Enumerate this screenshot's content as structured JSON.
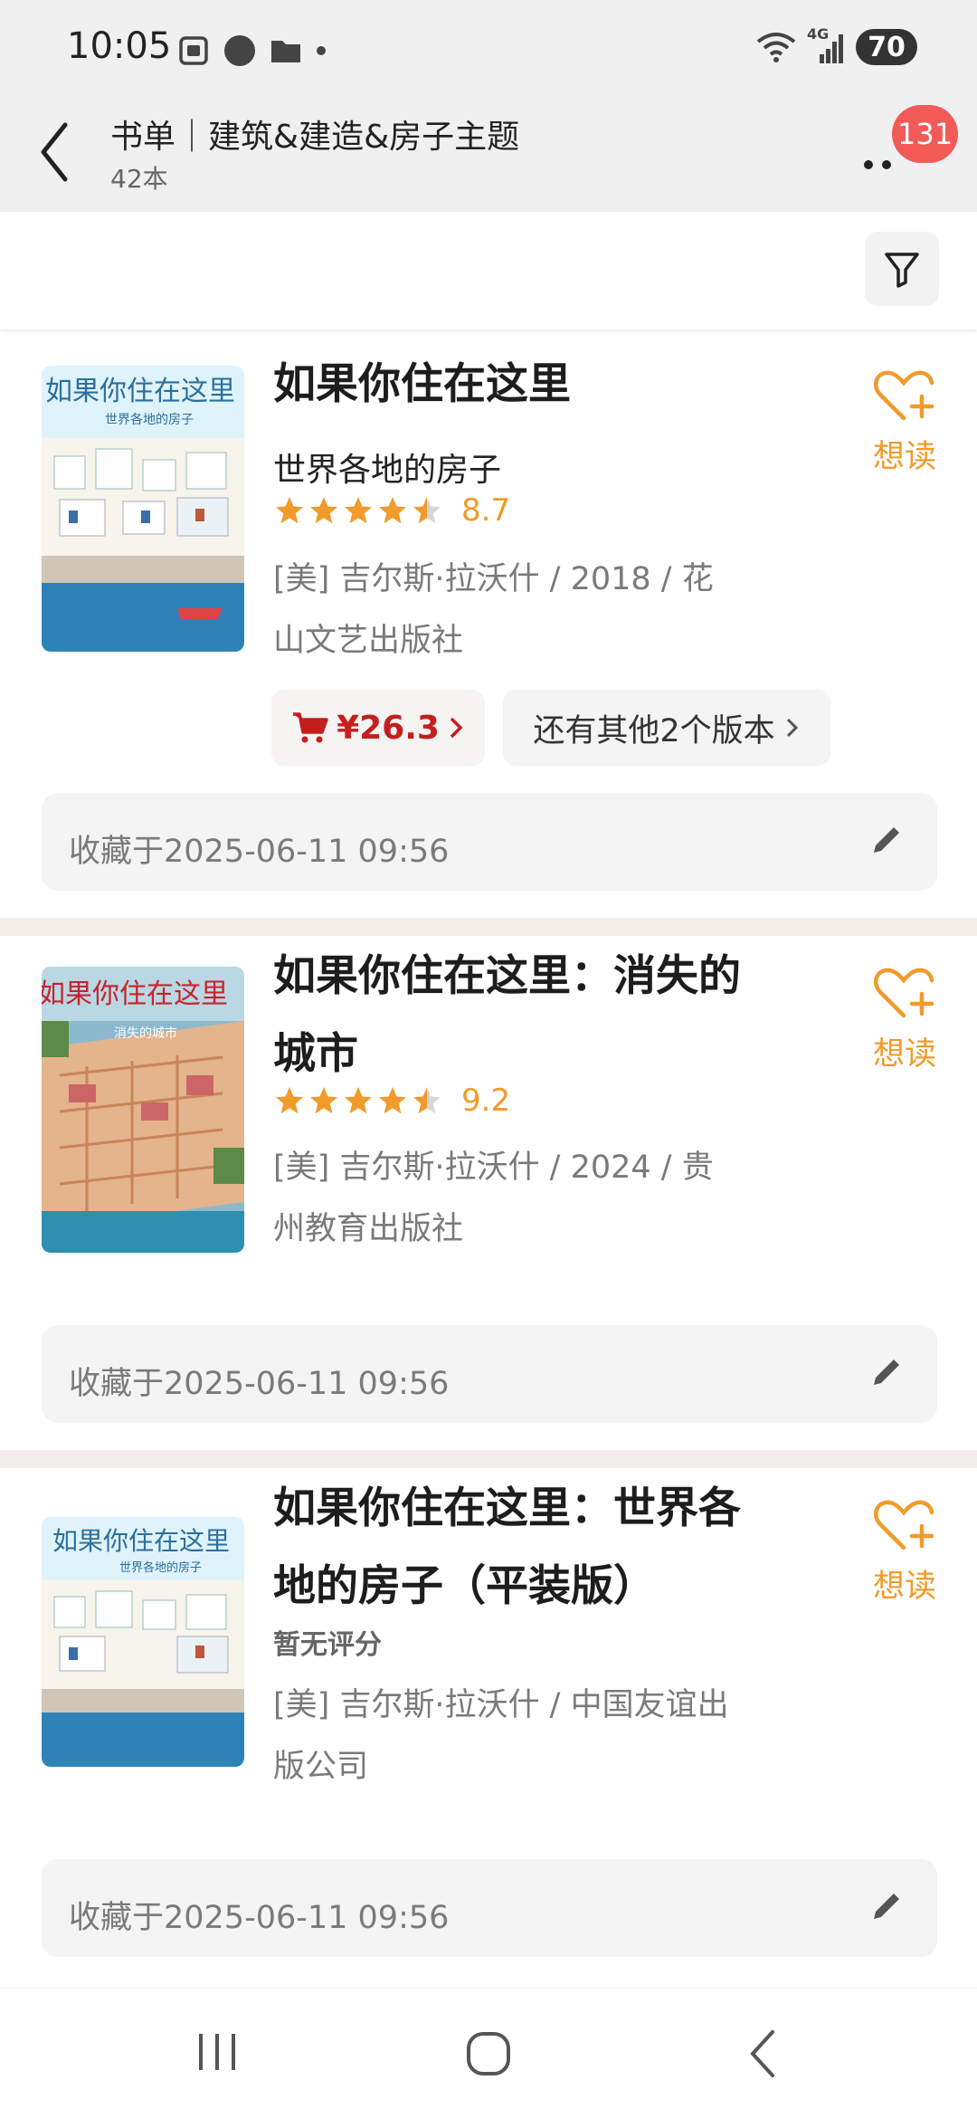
{
  "status_bar": {
    "time": "10:05",
    "network": "4G",
    "battery": "70"
  },
  "header": {
    "title": "书单｜建筑&建造&房子主题",
    "count": "42本",
    "notification_count": "131"
  },
  "books": [
    {
      "title": "如果你住在这里",
      "subtitle": "世界各地的房子",
      "rating": "8.7",
      "stars": 4.5,
      "meta": "[美] 吉尔斯·拉沃什 / 2018 / 花山文艺出版社",
      "want_label": "想读",
      "price": "¥26.3",
      "versions": "还有其他2个版本",
      "saved": "收藏于2025-06-11 09:56"
    },
    {
      "title": "如果你住在这里：消失的城市",
      "rating": "9.2",
      "stars": 4.5,
      "meta": "[美] 吉尔斯·拉沃什 / 2024 / 贵州教育出版社",
      "want_label": "想读",
      "saved": "收藏于2025-06-11 09:56"
    },
    {
      "title": "如果你住在这里：世界各地的房子（平装版）",
      "rating_text": "暂无评分",
      "meta": "[美] 吉尔斯·拉沃什 / 中国友谊出版公司",
      "want_label": "想读",
      "saved": "收藏于2025-06-11 09:56"
    }
  ],
  "covers": [
    {
      "title": "如果你住在这里",
      "subtitle": "世界各地的房子"
    },
    {
      "title": "如果你住在这里",
      "subtitle": "消失的城市"
    },
    {
      "title": "如果你住在这里",
      "subtitle": "世界各地的房子"
    }
  ],
  "colors": {
    "accent": "#f09b2a",
    "price": "#c41e1e",
    "badge": "#f25a57",
    "header_bg": "#f0f0f0"
  },
  "icons": [
    "back-icon",
    "more-icon",
    "filter-icon",
    "heart-plus-icon",
    "cart-icon",
    "pencil-icon",
    "recents-icon",
    "home-icon",
    "nav-back-icon"
  ]
}
